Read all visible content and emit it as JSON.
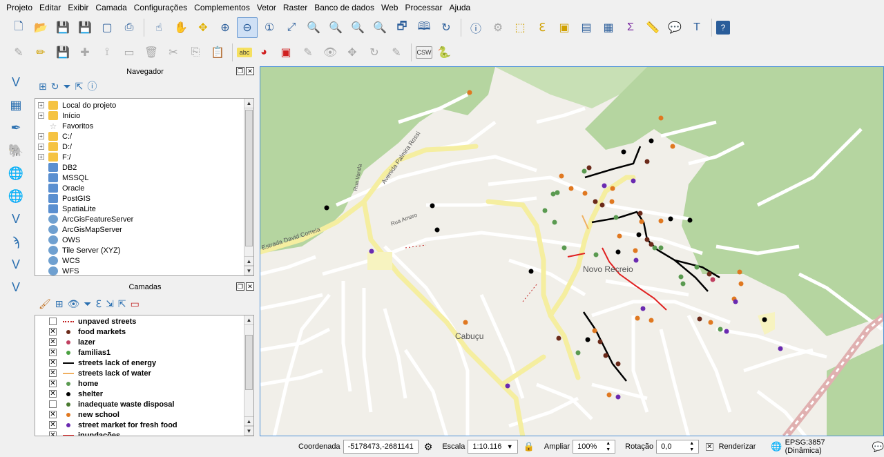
{
  "menu": [
    "Projeto",
    "Editar",
    "Exibir",
    "Camada",
    "Configurações",
    "Complementos",
    "Vetor",
    "Raster",
    "Banco de dados",
    "Web",
    "Processar",
    "Ajuda"
  ],
  "toolbar2_labels": {
    "csw": "CSW",
    "abc": "abc"
  },
  "browser": {
    "title": "Navegador",
    "items": [
      {
        "label": "Local do projeto",
        "icon": "folder-icon",
        "exp": true
      },
      {
        "label": "Início",
        "icon": "folder-icon",
        "exp": true
      },
      {
        "label": "Favoritos",
        "icon": "star-icon",
        "exp": false
      },
      {
        "label": "C:/",
        "icon": "folder-icon",
        "exp": true
      },
      {
        "label": "D:/",
        "icon": "folder-icon",
        "exp": true
      },
      {
        "label": "F:/",
        "icon": "folder-icon",
        "exp": true
      },
      {
        "label": "DB2",
        "icon": "db2-icon",
        "exp": false
      },
      {
        "label": "MSSQL",
        "icon": "mssql-icon",
        "exp": false
      },
      {
        "label": "Oracle",
        "icon": "oracle-icon",
        "exp": false
      },
      {
        "label": "PostGIS",
        "icon": "postgis-icon",
        "exp": false
      },
      {
        "label": "SpatiaLite",
        "icon": "spatialite-icon",
        "exp": false
      },
      {
        "label": "ArcGisFeatureServer",
        "icon": "globe-icon",
        "exp": false
      },
      {
        "label": "ArcGisMapServer",
        "icon": "globe-icon",
        "exp": false
      },
      {
        "label": "OWS",
        "icon": "globe-icon",
        "exp": false
      },
      {
        "label": "Tile Server (XYZ)",
        "icon": "tile-icon",
        "exp": false
      },
      {
        "label": "WCS",
        "icon": "globe-icon",
        "exp": false
      },
      {
        "label": "WFS",
        "icon": "globe-icon",
        "exp": false
      }
    ]
  },
  "layers": {
    "title": "Camadas",
    "items": [
      {
        "label": "unpaved streets",
        "checked": false,
        "sym": "dash",
        "color": "#c02020"
      },
      {
        "label": "food markets",
        "checked": true,
        "sym": "dot",
        "color": "#6b2a1a"
      },
      {
        "label": "lazer",
        "checked": true,
        "sym": "dot",
        "color": "#c04060"
      },
      {
        "label": "familias1",
        "checked": true,
        "sym": "dot",
        "color": "#4aa040"
      },
      {
        "label": "streets lack of energy",
        "checked": true,
        "sym": "line",
        "color": "#000000"
      },
      {
        "label": "streets lack of water",
        "checked": true,
        "sym": "line",
        "color": "#f0b060"
      },
      {
        "label": "home",
        "checked": true,
        "sym": "dot",
        "color": "#5a9a50"
      },
      {
        "label": "shelter",
        "checked": true,
        "sym": "dot",
        "color": "#000000"
      },
      {
        "label": "inadequate waste disposal",
        "checked": false,
        "sym": "dot",
        "color": "#4a7a30"
      },
      {
        "label": "new school",
        "checked": true,
        "sym": "dot",
        "color": "#e07820"
      },
      {
        "label": "street market for fresh food",
        "checked": true,
        "sym": "dot",
        "color": "#6a2ab0"
      },
      {
        "label": "inundações",
        "checked": true,
        "sym": "line",
        "color": "#e02020"
      }
    ]
  },
  "map": {
    "labels": {
      "novo_recreio": "Novo Recreio",
      "cabucu": "Cabuçu",
      "av_palmira_rossi": "Avenida Palmira Rossi",
      "estrada_david_correia": "Estrada David Correia",
      "rua_vanda": "Rua Vanda",
      "rua_amaro": "Rua Amaro"
    }
  },
  "status": {
    "coord_label": "Coordenada",
    "coord_value": "-5178473,-2681141",
    "scale_label": "Escala",
    "scale_value": "1:10.116",
    "magnify_label": "Ampliar",
    "magnify_value": "100%",
    "rotation_label": "Rotação",
    "rotation_value": "0,0",
    "render_label": "Renderizar",
    "crs": "EPSG:3857 (Dinâmica)"
  },
  "colors": {
    "accent": "#4a90d9",
    "map_bg": "#f1efe9",
    "forest": "#b5d5a0",
    "road_major": "#f5eea0"
  }
}
